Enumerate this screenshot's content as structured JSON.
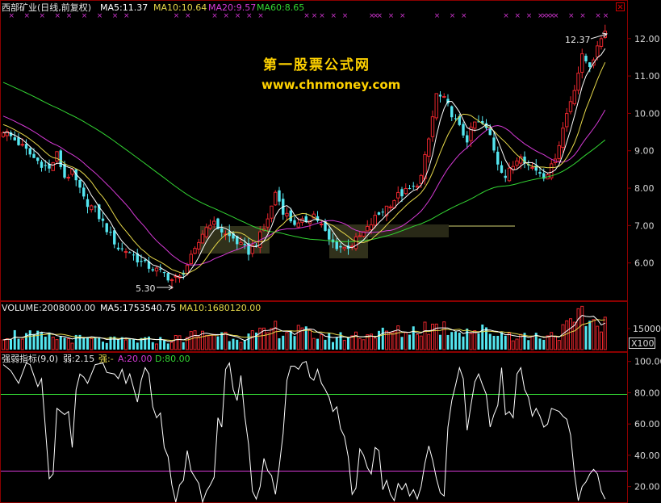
{
  "colors": {
    "background": "#000000",
    "frame": "#8b0000",
    "up": "#e8262d",
    "down": "#54e6f0",
    "ma5": "#ffffff",
    "ma10": "#e6d84a",
    "ma20": "#d63ad6",
    "ma60": "#33d633",
    "watermark": "#ffd200",
    "marker": "#cc33cc",
    "label_white": "#e8e8e8",
    "axis_text": "#d8d8d8",
    "level_high": "#33d633",
    "level_low": "#d63ad6"
  },
  "header": {
    "name": "西部矿业(日线,前复权)",
    "ma5": "MA5:11.37",
    "ma10": "MA10:10.64",
    "ma20": "MA20:9.57",
    "ma60": "MA60:8.65",
    "close_box_icon": "close-box-icon"
  },
  "watermark": {
    "title": "第一股票公式网",
    "url": "www.chnmoney.com"
  },
  "price_panel": {
    "high_label": "12.37",
    "low_label": "5.30",
    "yticks": [
      "6.00",
      "7.00",
      "8.00",
      "9.00",
      "10.00",
      "11.00",
      "12.00"
    ]
  },
  "volume_panel": {
    "label": "VOLUME:2008000.00",
    "ma5": "MA5:1753540.75",
    "ma10": "MA10:1680120.00",
    "ytick": "15000",
    "unit": "X100"
  },
  "indicator_panel": {
    "name": "强弱指标(9,0)",
    "weak": "弱:2.15",
    "strong": "强:-",
    "a": "A:20.00",
    "d": "D:80.00",
    "yticks": [
      "20.00",
      "40.00",
      "60.00",
      "80.00",
      "100.00"
    ]
  },
  "chart_data": {
    "type": "candlestick",
    "title": "西部矿业(日线,前复权)",
    "price_range": [
      5.0,
      12.6
    ],
    "price_high": 12.37,
    "price_low": 5.3,
    "ma_latest": {
      "MA5": 11.37,
      "MA10": 10.64,
      "MA20": 9.57,
      "MA60": 8.65
    },
    "volume_latest": 2008000,
    "volume_ma": {
      "MA5": 1753540.75,
      "MA10": 1680120.0
    },
    "indicator": {
      "name": "强弱指标",
      "params": [
        9,
        0
      ],
      "weak": 2.15,
      "A": 20,
      "D": 80,
      "range": [
        10,
        105
      ]
    },
    "close_anchors": [
      [
        0,
        9.55
      ],
      [
        4,
        9.2
      ],
      [
        8,
        8.8
      ],
      [
        12,
        8.5
      ],
      [
        14,
        8.9
      ],
      [
        16,
        8.3
      ],
      [
        18,
        8.4
      ],
      [
        21,
        7.7
      ],
      [
        24,
        7.4
      ],
      [
        27,
        6.9
      ],
      [
        30,
        6.4
      ],
      [
        33,
        6.3
      ],
      [
        36,
        6.0
      ],
      [
        39,
        5.85
      ],
      [
        42,
        5.7
      ],
      [
        44,
        5.55
      ],
      [
        46,
        5.6
      ],
      [
        48,
        5.95
      ],
      [
        50,
        6.3
      ],
      [
        52,
        6.8
      ],
      [
        54,
        7.1
      ],
      [
        56,
        6.95
      ],
      [
        58,
        6.75
      ],
      [
        60,
        6.65
      ],
      [
        62,
        6.45
      ],
      [
        64,
        6.3
      ],
      [
        66,
        6.55
      ],
      [
        68,
        6.9
      ],
      [
        70,
        7.5
      ],
      [
        71,
        7.9
      ],
      [
        73,
        7.4
      ],
      [
        75,
        7.15
      ],
      [
        77,
        7.0
      ],
      [
        79,
        7.15
      ],
      [
        81,
        7.3
      ],
      [
        83,
        7.0
      ],
      [
        85,
        6.6
      ],
      [
        87,
        6.45
      ],
      [
        89,
        6.4
      ],
      [
        91,
        6.5
      ],
      [
        93,
        6.7
      ],
      [
        95,
        6.9
      ],
      [
        97,
        7.2
      ],
      [
        99,
        7.4
      ],
      [
        101,
        7.6
      ],
      [
        103,
        7.8
      ],
      [
        105,
        7.9
      ],
      [
        107,
        8.0
      ],
      [
        109,
        8.3
      ],
      [
        111,
        9.3
      ],
      [
        113,
        10.5
      ],
      [
        115,
        10.35
      ],
      [
        117,
        10.0
      ],
      [
        119,
        9.6
      ],
      [
        121,
        9.3
      ],
      [
        123,
        9.75
      ],
      [
        125,
        9.7
      ],
      [
        127,
        9.4
      ],
      [
        129,
        8.7
      ],
      [
        131,
        8.3
      ],
      [
        133,
        8.6
      ],
      [
        135,
        8.95
      ],
      [
        137,
        8.6
      ],
      [
        139,
        8.5
      ],
      [
        141,
        8.35
      ],
      [
        143,
        8.55
      ],
      [
        145,
        9.2
      ],
      [
        147,
        10.0
      ],
      [
        149,
        10.7
      ],
      [
        151,
        11.5
      ],
      [
        153,
        11.3
      ],
      [
        155,
        11.7
      ],
      [
        157,
        12.37
      ]
    ],
    "volume_range": [
      0,
      30000
    ],
    "volume_anchors": [
      [
        0,
        10000
      ],
      [
        10,
        8000
      ],
      [
        20,
        6500
      ],
      [
        30,
        5500
      ],
      [
        44,
        6000
      ],
      [
        50,
        9000
      ],
      [
        56,
        10000
      ],
      [
        62,
        8000
      ],
      [
        68,
        9500
      ],
      [
        71,
        13000
      ],
      [
        78,
        10500
      ],
      [
        85,
        7500
      ],
      [
        95,
        9500
      ],
      [
        105,
        11000
      ],
      [
        111,
        14500
      ],
      [
        115,
        13500
      ],
      [
        121,
        12500
      ],
      [
        129,
        10500
      ],
      [
        137,
        8000
      ],
      [
        145,
        10000
      ],
      [
        151,
        19000
      ],
      [
        155,
        16500
      ],
      [
        157,
        20000
      ]
    ],
    "indicator_anchors": [
      [
        0,
        98
      ],
      [
        2,
        94
      ],
      [
        4,
        86
      ],
      [
        6,
        99
      ],
      [
        7,
        98
      ],
      [
        9,
        84
      ],
      [
        10,
        89
      ],
      [
        11,
        57
      ],
      [
        12,
        25
      ],
      [
        13,
        28
      ],
      [
        14,
        70
      ],
      [
        16,
        66
      ],
      [
        17,
        68
      ],
      [
        18,
        45
      ],
      [
        19,
        82
      ],
      [
        20,
        92
      ],
      [
        21,
        90
      ],
      [
        22,
        86
      ],
      [
        24,
        98
      ],
      [
        26,
        99
      ],
      [
        27,
        93
      ],
      [
        29,
        92
      ],
      [
        30,
        89
      ],
      [
        31,
        95
      ],
      [
        32,
        86
      ],
      [
        33,
        92
      ],
      [
        35,
        74
      ],
      [
        36,
        88
      ],
      [
        37,
        96
      ],
      [
        38,
        92
      ],
      [
        39,
        71
      ],
      [
        40,
        64
      ],
      [
        41,
        67
      ],
      [
        42,
        45
      ],
      [
        43,
        39
      ],
      [
        44,
        21
      ],
      [
        45,
        10
      ],
      [
        46,
        21
      ],
      [
        47,
        24
      ],
      [
        48,
        43
      ],
      [
        49,
        30
      ],
      [
        51,
        22
      ],
      [
        52,
        10
      ],
      [
        53,
        17
      ],
      [
        54,
        21
      ],
      [
        55,
        26
      ],
      [
        56,
        64
      ],
      [
        57,
        58
      ],
      [
        58,
        95
      ],
      [
        59,
        99
      ],
      [
        60,
        82
      ],
      [
        61,
        75
      ],
      [
        62,
        91
      ],
      [
        63,
        65
      ],
      [
        64,
        47
      ],
      [
        65,
        17
      ],
      [
        66,
        12
      ],
      [
        67,
        20
      ],
      [
        68,
        38
      ],
      [
        69,
        30
      ],
      [
        70,
        27
      ],
      [
        71,
        15
      ],
      [
        72,
        33
      ],
      [
        73,
        54
      ],
      [
        74,
        88
      ],
      [
        75,
        97
      ],
      [
        76,
        97
      ],
      [
        77,
        95
      ],
      [
        78,
        99
      ],
      [
        79,
        100
      ],
      [
        80,
        90
      ],
      [
        81,
        88
      ],
      [
        82,
        95
      ],
      [
        83,
        86
      ],
      [
        84,
        82
      ],
      [
        85,
        77
      ],
      [
        86,
        68
      ],
      [
        87,
        71
      ],
      [
        88,
        57
      ],
      [
        89,
        52
      ],
      [
        90,
        39
      ],
      [
        91,
        15
      ],
      [
        92,
        19
      ],
      [
        93,
        44
      ],
      [
        94,
        40
      ],
      [
        95,
        32
      ],
      [
        96,
        28
      ],
      [
        97,
        45
      ],
      [
        98,
        43
      ],
      [
        99,
        18
      ],
      [
        100,
        24
      ],
      [
        101,
        15
      ],
      [
        102,
        11
      ],
      [
        103,
        22
      ],
      [
        104,
        18
      ],
      [
        105,
        22
      ],
      [
        106,
        14
      ],
      [
        107,
        18
      ],
      [
        108,
        12
      ],
      [
        109,
        20
      ],
      [
        110,
        35
      ],
      [
        111,
        46
      ],
      [
        112,
        37
      ],
      [
        113,
        25
      ],
      [
        114,
        16
      ],
      [
        115,
        14
      ],
      [
        116,
        58
      ],
      [
        117,
        75
      ],
      [
        118,
        85
      ],
      [
        119,
        96
      ],
      [
        120,
        89
      ],
      [
        121,
        56
      ],
      [
        122,
        72
      ],
      [
        123,
        87
      ],
      [
        124,
        92
      ],
      [
        125,
        85
      ],
      [
        126,
        79
      ],
      [
        127,
        58
      ],
      [
        128,
        66
      ],
      [
        129,
        72
      ],
      [
        130,
        96
      ],
      [
        131,
        66
      ],
      [
        132,
        68
      ],
      [
        133,
        64
      ],
      [
        134,
        92
      ],
      [
        135,
        96
      ],
      [
        136,
        82
      ],
      [
        137,
        77
      ],
      [
        138,
        65
      ],
      [
        139,
        70
      ],
      [
        140,
        65
      ],
      [
        141,
        58
      ],
      [
        142,
        60
      ],
      [
        143,
        70
      ],
      [
        144,
        69
      ],
      [
        145,
        68
      ],
      [
        146,
        65
      ],
      [
        147,
        63
      ],
      [
        148,
        53
      ],
      [
        149,
        28
      ],
      [
        150,
        11
      ],
      [
        151,
        20
      ],
      [
        152,
        23
      ],
      [
        153,
        28
      ],
      [
        154,
        31
      ],
      [
        155,
        28
      ],
      [
        156,
        17
      ],
      [
        157,
        12
      ]
    ],
    "marker_indices": [
      2,
      6,
      10,
      14,
      17,
      21,
      25,
      29,
      32,
      45,
      48,
      55,
      58,
      61,
      64,
      67,
      79,
      81,
      83,
      86,
      89,
      96,
      97,
      98,
      101,
      104,
      113,
      117,
      120,
      131,
      134,
      137,
      140,
      141,
      142,
      143,
      144,
      148,
      151,
      155,
      157
    ]
  }
}
